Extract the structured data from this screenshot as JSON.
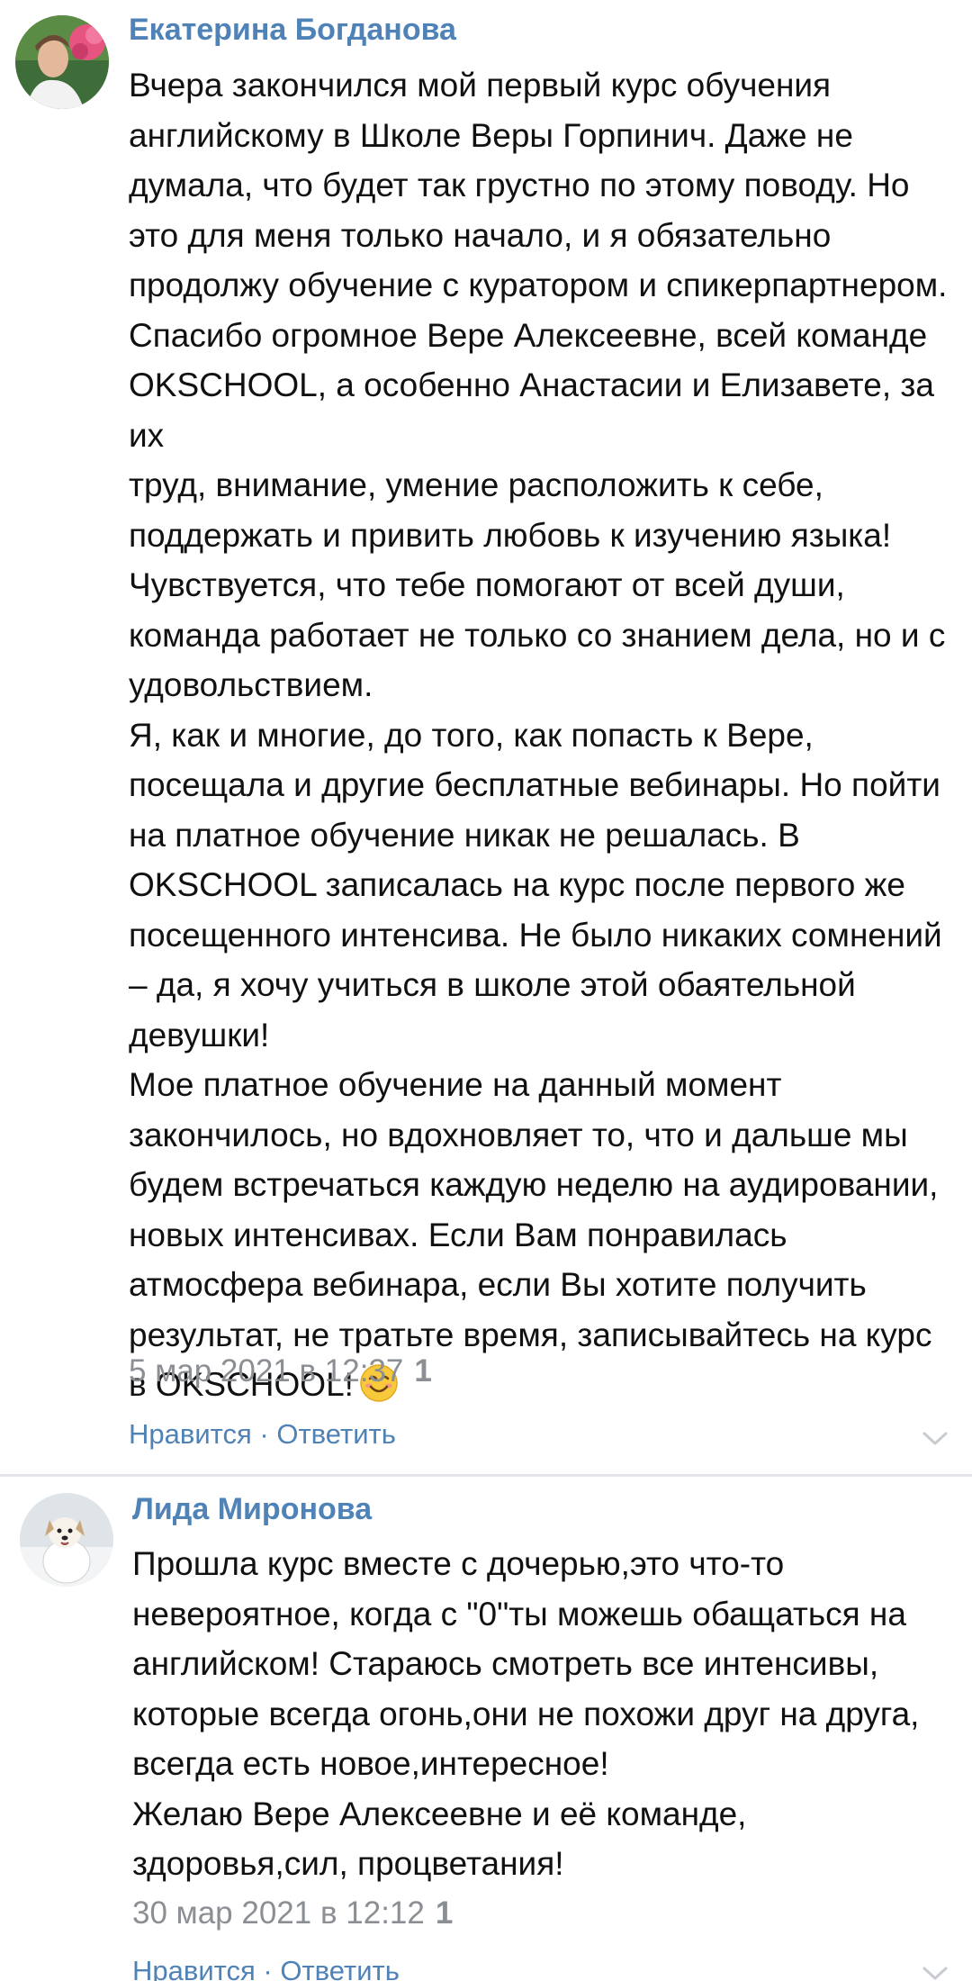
{
  "comments": [
    {
      "author": "Екатерина Богданова",
      "avatar_icon": "avatar-woman-with-flower",
      "lines": [
        "Вчера закончился мой первый курс обучения",
        "английскому в Школе Веры Горпинич. Даже не",
        "думала, что будет так грустно по этому поводу. Но",
        "это для меня только начало, и я обязательно",
        "продолжу обучение с куратором и спикерпартнером.",
        "Спасибо огромное Вере Алексеевне, всей команде",
        "OKSCHOOL, а особенно Анастасии и Елизавете, за их",
        "труд, внимание, умение расположить к себе,",
        "поддержать и привить любовь к изучению языка!",
        "Чувствуется, что тебе помогают от всей души,",
        "команда работает не только со знанием дела, но и с",
        "удовольствием.",
        "Я, как и многие, до того, как попасть к Вере,",
        "посещала и другие бесплатные вебинары. Но пойти",
        "на платное обучение никак не решалась. В",
        "OKSCHOOL записалась на курс после первого же",
        "посещенного интенсива. Не было никаких сомнений",
        "– да, я хочу учиться в школе этой обаятельной",
        "девушки!",
        "Мое платное обучение на данный момент",
        "закончилось, но вдохновляет то, что и дальше мы",
        "будем встречаться каждую неделю на аудировании,",
        "новых интенсивах. Если Вам понравилась",
        "атмосфера вебинара, если Вы хотите получить",
        "результат, не тратьте время, записывайтесь на курс",
        "в OKSCHOOL!"
      ],
      "date": "5 мар 2021 в 12:37",
      "likes": "1",
      "like_label": "Нравится",
      "separator": " · ",
      "reply_label": "Ответить"
    },
    {
      "author": "Лида Миронова",
      "avatar_icon": "avatar-white-dog",
      "lines": [
        "Прошла курс вместе с дочерью,это что-то",
        "невероятное, когда с \"0\"ты можешь обащаться на",
        "английском! Стараюсь смотреть все интенсивы,",
        "которые всегда огонь,они не похожи друг на друга,",
        "всегда есть новое,интересное!",
        "Желаю Вере Алексеевне и её команде,",
        "здоровья,сил, процветания!"
      ],
      "date": "30 мар 2021 в 12:12",
      "likes": "1",
      "like_label": "Нравится",
      "separator": " · ",
      "reply_label": "Ответить"
    }
  ],
  "colors": {
    "link": "#4f82b7",
    "meta": "#8b8f94",
    "text": "#111111",
    "divider": "#e3e5e8"
  }
}
